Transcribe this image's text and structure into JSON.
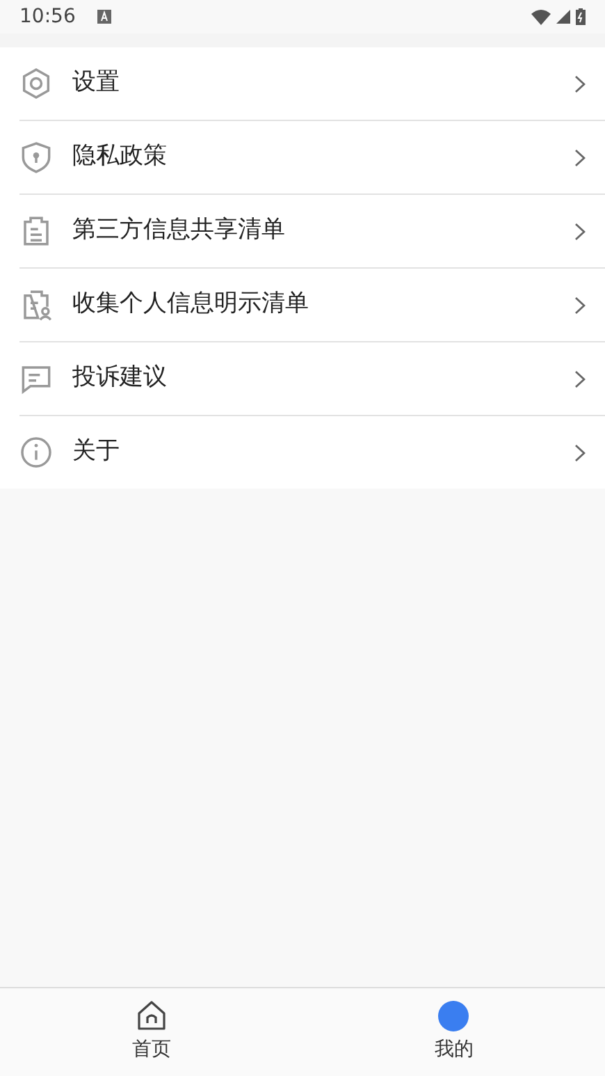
{
  "status_bar": {
    "time": "10:56"
  },
  "menu": [
    {
      "kind": "settings",
      "label": "设置"
    },
    {
      "kind": "shield",
      "label": "隐私政策"
    },
    {
      "kind": "list",
      "label": "第三方信息共享清单"
    },
    {
      "kind": "person-list",
      "label": "收集个人信息明示清单"
    },
    {
      "kind": "message",
      "label": "投诉建议"
    },
    {
      "kind": "info",
      "label": "关于"
    }
  ],
  "tabs": [
    {
      "kind": "home",
      "label": "首页",
      "selected": false
    },
    {
      "kind": "profile",
      "label": "我的",
      "selected": true
    }
  ]
}
